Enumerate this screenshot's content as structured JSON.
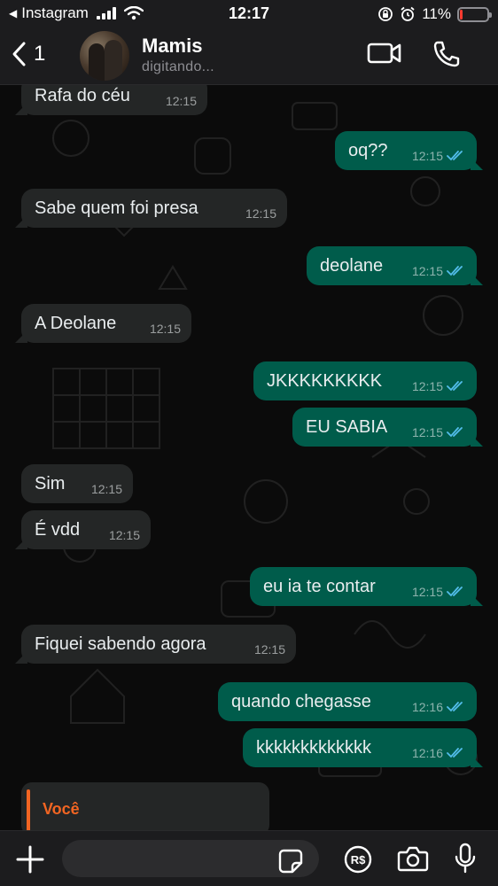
{
  "status_bar": {
    "back_app": "Instagram",
    "time": "12:17",
    "battery": "11%",
    "battery_level": 0.11
  },
  "header": {
    "back_count": "1",
    "contact_name": "Mamis",
    "contact_status": "digitando..."
  },
  "messages": [
    {
      "dir": "in",
      "text": "Rafa do céu",
      "time": "12:15"
    },
    {
      "dir": "out",
      "text": "oq??",
      "time": "12:15"
    },
    {
      "dir": "in",
      "text": "Sabe quem foi presa",
      "time": "12:15"
    },
    {
      "dir": "out",
      "text": "deolane",
      "time": "12:15"
    },
    {
      "dir": "in",
      "text": "A Deolane",
      "time": "12:15"
    },
    {
      "dir": "out",
      "text": "JKKKKKKKKK",
      "time": "12:15"
    },
    {
      "dir": "out",
      "text": "EU SABIA",
      "time": "12:15"
    },
    {
      "dir": "in",
      "text": "Sim",
      "time": "12:15"
    },
    {
      "dir": "in",
      "text": "É vdd",
      "time": "12:15"
    },
    {
      "dir": "out",
      "text": "eu ia te contar",
      "time": "12:15"
    },
    {
      "dir": "in",
      "text": "Fiquei sabendo agora",
      "time": "12:15"
    },
    {
      "dir": "out",
      "text": "quando chegasse",
      "time": "12:16"
    },
    {
      "dir": "out",
      "text": "kkkkkkkkkkkkk",
      "time": "12:16"
    }
  ],
  "reply_preview": {
    "author": "Você"
  },
  "input": {
    "placeholder": ""
  },
  "colors": {
    "incoming_bubble": "#242626",
    "outgoing_bubble": "#005c4b",
    "read_ticks": "#53bdeb",
    "reply_accent": "#f26522"
  },
  "icons": [
    "back-chevron-icon",
    "video-call-icon",
    "phone-icon",
    "plus-icon",
    "sticker-icon",
    "pix-payment-icon",
    "camera-icon",
    "microphone-icon"
  ]
}
